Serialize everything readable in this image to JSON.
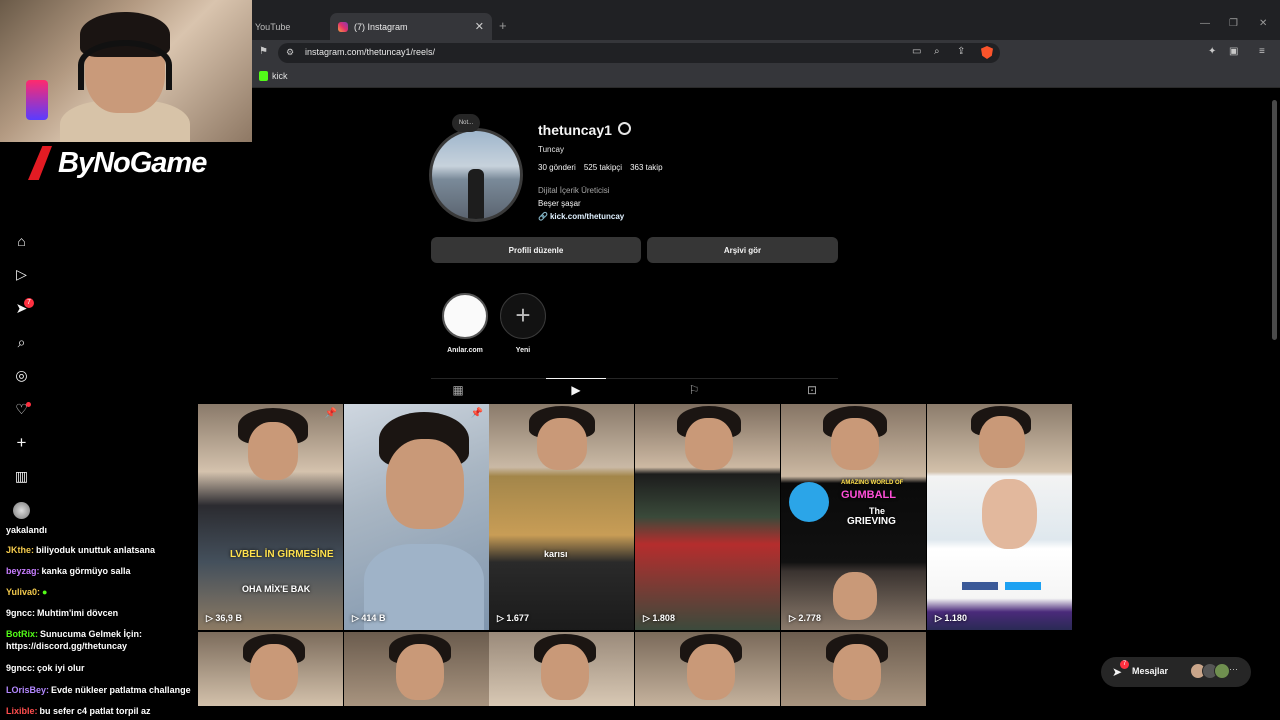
{
  "browser": {
    "tabs": [
      {
        "label": "YouTube"
      },
      {
        "label": "(7) Instagram"
      }
    ],
    "url": "instagram.com/thetuncay1/reels/",
    "bookmark": "kick"
  },
  "overlay": {
    "brand": "ByNoGame"
  },
  "sidebar": {
    "notification_count": "7"
  },
  "profile": {
    "note": "Not...",
    "username": "thetuncay1",
    "full_name": "Tuncay",
    "posts": "30 gönderi",
    "followers": "525 takipçi",
    "following": "363 takip",
    "category": "Dijital İçerik Üreticisi",
    "bio": "Beşer şaşar",
    "link": "kick.com/thetuncay",
    "edit_button": "Profili düzenle",
    "archive_button": "Arşivi gör",
    "highlights": [
      {
        "label": "Anılar.com"
      },
      {
        "label": "Yeni"
      }
    ]
  },
  "reels": {
    "views": [
      "36,9 B",
      "414 B",
      "1.677",
      "1.808",
      "2.778",
      "1.180"
    ],
    "captions": {
      "c1": "LVBEL İN GİRMESİNE",
      "c2": "OHA MİX'E BAK",
      "c3": "karısı",
      "c4a": "AMAZING WORLD OF",
      "c4b": "GUMBALL",
      "c4c": "The",
      "c4d": "GRIEVING"
    }
  },
  "chat": [
    {
      "user": "",
      "text": "yakalandı",
      "color": "#ffffff"
    },
    {
      "user": "JKthe:",
      "text": "biliyoduk unuttuk anlatsana",
      "color": "#f2c94c"
    },
    {
      "user": "beyzag:",
      "text": "kanka görmüyo salla",
      "color": "#c77dff"
    },
    {
      "user": "Yuliva0:",
      "text": "",
      "color": "#f2c94c"
    },
    {
      "user": "9gncc:",
      "text": "Muhtim'imi dövcen",
      "color": "#ffffff"
    },
    {
      "user": "BotRix:",
      "text": "Sunucuma Gelmek İçin: https://discord.gg/thetuncay",
      "color": "#53fc18"
    },
    {
      "user": "9gncc:",
      "text": "çok iyi olur",
      "color": "#ffffff"
    },
    {
      "user": "LOrisBey:",
      "text": "Evde nükleer patlatma challange",
      "color": "#b388ff"
    },
    {
      "user": "Lixible:",
      "text": "bu sefer c4 patlat torpil az",
      "color": "#ff4d4d"
    }
  ],
  "messages": {
    "label": "Mesajlar",
    "count": "7"
  }
}
